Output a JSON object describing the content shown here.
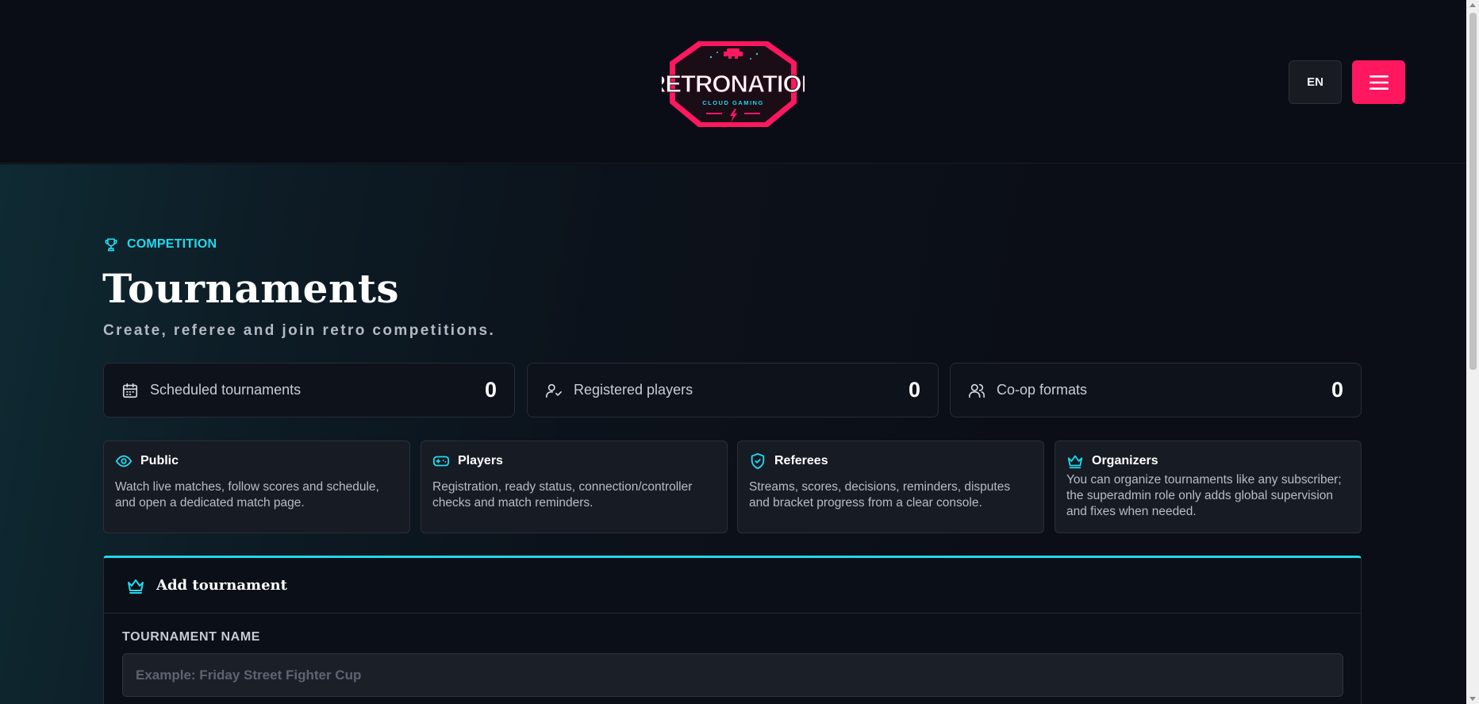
{
  "header": {
    "logo": {
      "text": "RETRONATION",
      "tagline": "CLOUD GAMING"
    },
    "lang_label": "EN",
    "menu_icon": "hamburger-icon"
  },
  "colors": {
    "accent_cyan": "#23d8ee",
    "accent_pink": "#ff1760",
    "background": "#0b0e16"
  },
  "hero": {
    "eyebrow": "COMPETITION",
    "eyebrow_icon": "trophy-icon",
    "title": "Tournaments",
    "subtitle": "Create, referee and join retro competitions."
  },
  "stats": [
    {
      "icon": "calendar-icon",
      "label": "Scheduled tournaments",
      "value": "0"
    },
    {
      "icon": "user-check-icon",
      "label": "Registered players",
      "value": "0"
    },
    {
      "icon": "users-icon",
      "label": "Co-op formats",
      "value": "0"
    }
  ],
  "roles": [
    {
      "icon": "eye-icon",
      "name": "Public",
      "desc": "Watch live matches, follow scores and schedule, and open a dedicated match page."
    },
    {
      "icon": "gamepad-icon",
      "name": "Players",
      "desc": "Registration, ready status, connection/controller checks and match reminders."
    },
    {
      "icon": "shield-check-icon",
      "name": "Referees",
      "desc": "Streams, scores, decisions, reminders, disputes and bracket progress from a clear console."
    },
    {
      "icon": "crown-icon",
      "name": "Organizers",
      "desc": "You can organize tournaments like any subscriber; the superadmin role only adds global supervision and fixes when needed."
    }
  ],
  "form": {
    "icon": "crown-icon",
    "title": "Add tournament",
    "name_label": "TOURNAMENT NAME",
    "name_placeholder": "Example: Friday Street Fighter Cup",
    "name_value": ""
  }
}
